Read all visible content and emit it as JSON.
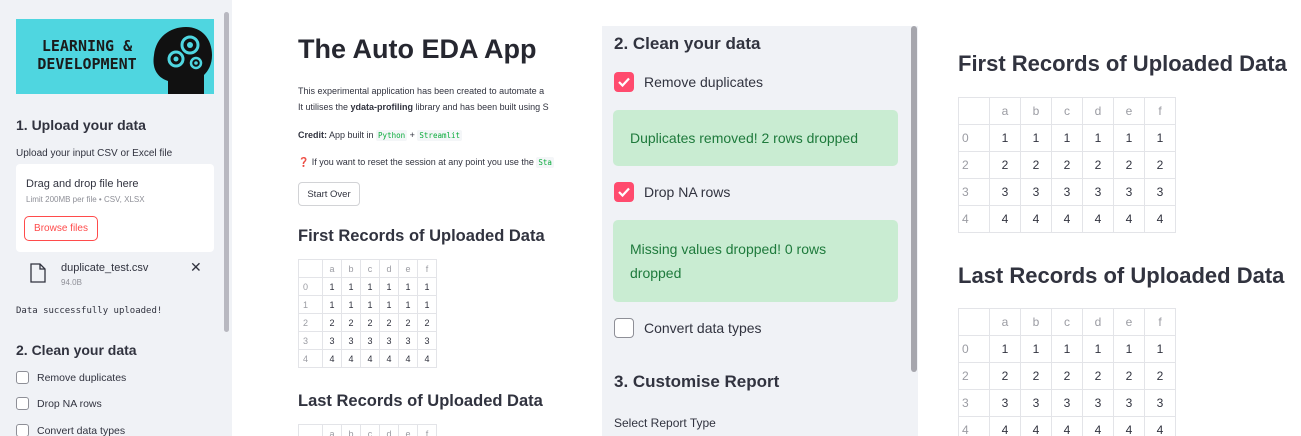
{
  "sidebar": {
    "logo_text_line1": "LEARNING &",
    "logo_text_line2": "DEVELOPMENT",
    "upload_heading": "1. Upload your data",
    "upload_caption": "Upload your input CSV or Excel file",
    "dropzone_title": "Drag and drop file here",
    "dropzone_limit": "Limit 200MB per file • CSV, XLSX",
    "browse_label": "Browse files",
    "file_name": "duplicate_test.csv",
    "file_size": "94.0B",
    "close_glyph": "✕",
    "upload_message": "Data successfully uploaded!",
    "clean_heading": "2. Clean your data",
    "options": [
      "Remove duplicates",
      "Drop NA rows",
      "Convert data types"
    ]
  },
  "main": {
    "title": "The Auto EDA App",
    "intro_line1": "This experimental application has been created to automate a",
    "intro_line2_a": "It utilises the ",
    "intro_line2_bold": "ydata-profiling",
    "intro_line2_b": " library and has been built using S",
    "credit_label": "Credit:",
    "credit_text": " App built in ",
    "credit_python": "Python",
    "credit_plus": " + ",
    "credit_streamlit": "Streamlit",
    "reset_icon_glyph": "❓",
    "reset_text": " If you want to reset the session at any point you use the ",
    "reset_code": "Sta",
    "start_over_label": "Start Over",
    "first_heading": "First Records of Uploaded Data",
    "last_heading": "Last Records of Uploaded Data",
    "columns": [
      "a",
      "b",
      "c",
      "d",
      "e",
      "f"
    ],
    "first_rows": [
      {
        "index": "0",
        "values": [
          "1",
          "1",
          "1",
          "1",
          "1",
          "1"
        ]
      },
      {
        "index": "1",
        "values": [
          "1",
          "1",
          "1",
          "1",
          "1",
          "1"
        ]
      },
      {
        "index": "2",
        "values": [
          "2",
          "2",
          "2",
          "2",
          "2",
          "2"
        ]
      },
      {
        "index": "3",
        "values": [
          "3",
          "3",
          "3",
          "3",
          "3",
          "3"
        ]
      },
      {
        "index": "4",
        "values": [
          "4",
          "4",
          "4",
          "4",
          "4",
          "4"
        ]
      }
    ]
  },
  "clean_panel": {
    "heading": "2. Clean your data",
    "remove_duplicates_label": "Remove duplicates",
    "duplicates_msg": "Duplicates removed! 2 rows dropped",
    "drop_na_label": "Drop NA rows",
    "na_msg_line1": "Missing values dropped! 0 rows",
    "na_msg_line2": "dropped",
    "convert_label": "Convert data types",
    "customise_heading": "3. Customise Report",
    "report_type_label": "Select Report Type",
    "check_glyph": "✓"
  },
  "cleaned_tables": {
    "first_heading": "First Records of Uploaded Data",
    "last_heading": "Last Records of Uploaded Data",
    "columns": [
      "a",
      "b",
      "c",
      "d",
      "e",
      "f"
    ],
    "first_rows": [
      {
        "index": "0",
        "values": [
          "1",
          "1",
          "1",
          "1",
          "1",
          "1"
        ]
      },
      {
        "index": "2",
        "values": [
          "2",
          "2",
          "2",
          "2",
          "2",
          "2"
        ]
      },
      {
        "index": "3",
        "values": [
          "3",
          "3",
          "3",
          "3",
          "3",
          "3"
        ]
      },
      {
        "index": "4",
        "values": [
          "4",
          "4",
          "4",
          "4",
          "4",
          "4"
        ]
      }
    ],
    "last_rows": [
      {
        "index": "0",
        "values": [
          "1",
          "1",
          "1",
          "1",
          "1",
          "1"
        ]
      },
      {
        "index": "2",
        "values": [
          "2",
          "2",
          "2",
          "2",
          "2",
          "2"
        ]
      },
      {
        "index": "3",
        "values": [
          "3",
          "3",
          "3",
          "3",
          "3",
          "3"
        ]
      },
      {
        "index": "4",
        "values": [
          "4",
          "4",
          "4",
          "4",
          "4",
          "4"
        ]
      }
    ]
  },
  "colors": {
    "accent": "#ff4b4b",
    "checkbox_checked": "#ff4b6e",
    "sidebar_bg": "#f0f2f6",
    "logo_bg": "#4fd6e0",
    "success_bg": "#c9ecd2",
    "success_text": "#1e7a3c"
  }
}
